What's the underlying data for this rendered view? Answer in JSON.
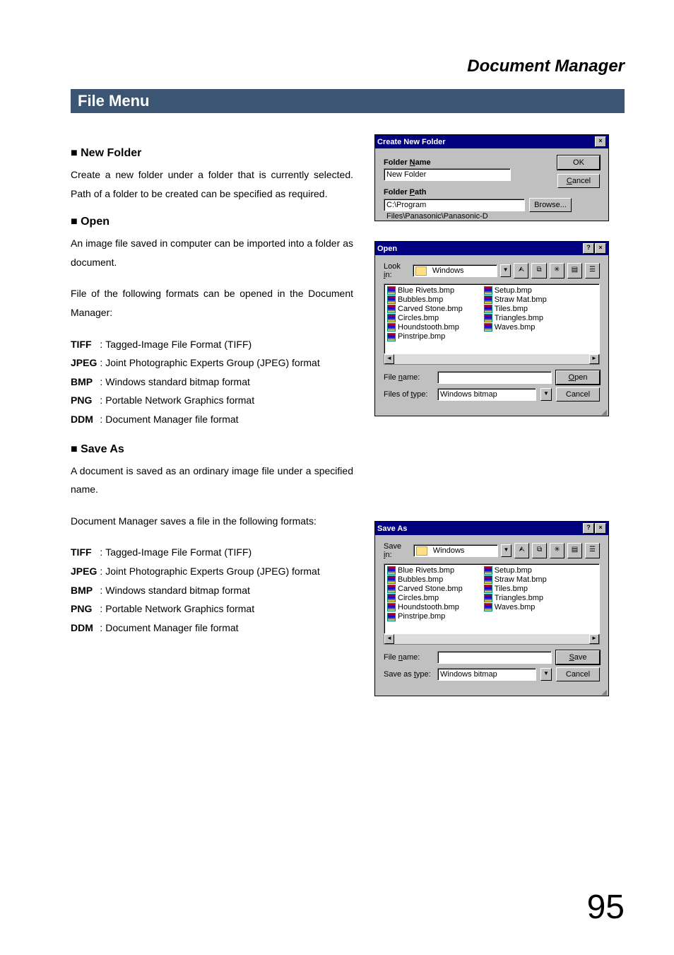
{
  "doc_title": "Document Manager",
  "section_title": "File Menu",
  "page_number": "95",
  "new_folder": {
    "heading": "New Folder",
    "text": "Create a new folder under a folder that is currently selected.  Path of a folder to be created can be specified as required."
  },
  "open": {
    "heading": "Open",
    "text1": "An image file saved in computer can be imported into a folder as document.",
    "text2": "File of the following formats can be opened in the Document Manager:"
  },
  "save_as": {
    "heading": "Save As",
    "text1": "A document is saved as an ordinary image file under a specified name.",
    "text2": "Document Manager saves a file in the following formats:"
  },
  "formats_open": [
    {
      "k": "TIFF",
      "v": "Tagged-Image File Format (TIFF)"
    },
    {
      "k": "JPEG",
      "v": "Joint Photographic Experts Group (JPEG) format"
    },
    {
      "k": "BMP",
      "v": "Windows standard bitmap format"
    },
    {
      "k": "PNG",
      "v": "Portable Network Graphics format"
    },
    {
      "k": "DDM",
      "v": "Document Manager file format"
    }
  ],
  "formats_save": [
    {
      "k": "TIFF",
      "v": "Tagged-Image File Format (TIFF)"
    },
    {
      "k": "JPEG",
      "v": "Joint Photographic Experts Group (JPEG) format"
    },
    {
      "k": "BMP",
      "v": "Windows standard bitmap format"
    },
    {
      "k": "PNG",
      "v": "Portable Network Graphics format"
    },
    {
      "k": "DDM",
      "v": "Document Manager file format"
    }
  ],
  "dlg_new_folder": {
    "title": "Create New Folder",
    "lbl_name": "Folder Name",
    "name_value": "New Folder",
    "lbl_path": "Folder Path",
    "path_value": "C:\\Program Files\\Panasonic\\Panasonic-D",
    "btn_ok": "OK",
    "btn_cancel": "Cancel",
    "btn_browse": "Browse..."
  },
  "dlg_open": {
    "title": "Open",
    "lbl_lookin": "Look in:",
    "lookin_value": "Windows",
    "lbl_filename": "File name:",
    "filename_value": "",
    "lbl_type": "Files of type:",
    "type_value": "Windows bitmap",
    "btn_open": "Open",
    "btn_cancel": "Cancel"
  },
  "dlg_save": {
    "title": "Save As",
    "lbl_savein": "Save in:",
    "savein_value": "Windows",
    "lbl_filename": "File name:",
    "filename_value": "",
    "lbl_type": "Save as type:",
    "type_value": "Windows bitmap",
    "btn_save": "Save",
    "btn_cancel": "Cancel"
  },
  "file_list": {
    "col1": [
      "Blue Rivets.bmp",
      "Bubbles.bmp",
      "Carved Stone.bmp",
      "Circles.bmp",
      "Houndstooth.bmp",
      "Pinstripe.bmp"
    ],
    "col2": [
      "Setup.bmp",
      "Straw Mat.bmp",
      "Tiles.bmp",
      "Triangles.bmp",
      "Waves.bmp"
    ]
  }
}
